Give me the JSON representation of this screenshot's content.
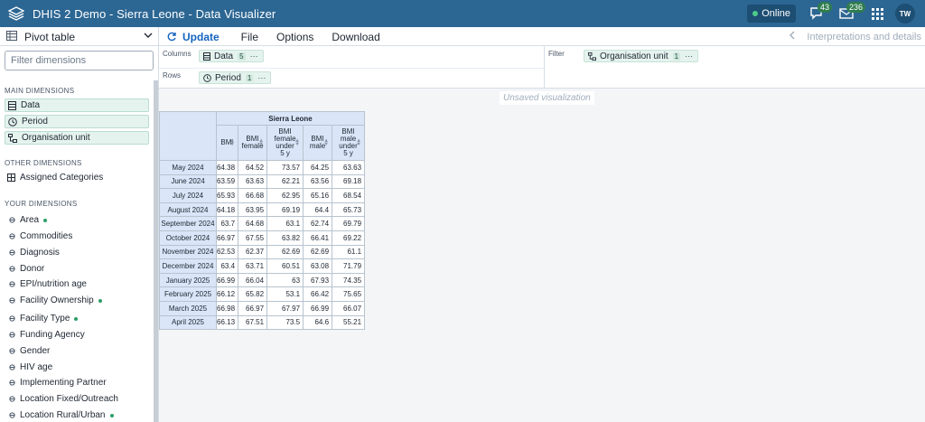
{
  "header": {
    "title": "DHIS 2 Demo - Sierra Leone - Data Visualizer",
    "status": "Online",
    "interpretations_badge": "43",
    "messages_badge": "236",
    "user_initials": "TW"
  },
  "toolbar": {
    "vis_type": "Pivot table",
    "update": "Update",
    "file": "File",
    "options": "Options",
    "download": "Download",
    "interpretations": "Interpretations and details"
  },
  "sidebar": {
    "filter_placeholder": "Filter dimensions",
    "main_title": "MAIN DIMENSIONS",
    "main": [
      "Data",
      "Period",
      "Organisation unit"
    ],
    "other_title": "OTHER DIMENSIONS",
    "other": [
      "Assigned Categories"
    ],
    "your_title": "YOUR DIMENSIONS",
    "your": [
      {
        "label": "Area",
        "active": true
      },
      {
        "label": "Commodities",
        "active": false
      },
      {
        "label": "Diagnosis",
        "active": false
      },
      {
        "label": "Donor",
        "active": false
      },
      {
        "label": "EPI/nutrition age",
        "active": false
      },
      {
        "label": "Facility Ownership",
        "active": true
      },
      {
        "label": "Facility Type",
        "active": true
      },
      {
        "label": "Funding Agency",
        "active": false
      },
      {
        "label": "Gender",
        "active": false
      },
      {
        "label": "HIV age",
        "active": false
      },
      {
        "label": "Implementing Partner",
        "active": false
      },
      {
        "label": "Location Fixed/Outreach",
        "active": false
      },
      {
        "label": "Location Rural/Urban",
        "active": true
      }
    ]
  },
  "layout": {
    "columns_label": "Columns",
    "rows_label": "Rows",
    "filter_label": "Filter",
    "columns_chip": {
      "label": "Data",
      "count": "5"
    },
    "rows_chip": {
      "label": "Period",
      "count": "1"
    },
    "filter_chip": {
      "label": "Organisation unit",
      "count": "1"
    }
  },
  "canvas": {
    "unsaved": "Unsaved visualization"
  },
  "table": {
    "org_unit": "Sierra Leone",
    "columns": [
      [
        "BMI"
      ],
      [
        "BMI",
        "female"
      ],
      [
        "BMI",
        "female",
        "under",
        "5 y"
      ],
      [
        "BMI",
        "male"
      ],
      [
        "BMI",
        "male",
        "under",
        "5 y"
      ]
    ],
    "rows": [
      {
        "period": "May 2024",
        "values": [
          "64.38",
          "64.52",
          "73.57",
          "64.25",
          "63.63"
        ]
      },
      {
        "period": "June 2024",
        "values": [
          "63.59",
          "63.63",
          "62.21",
          "63.56",
          "69.18"
        ]
      },
      {
        "period": "July 2024",
        "values": [
          "65.93",
          "66.68",
          "62.95",
          "65.16",
          "68.54"
        ]
      },
      {
        "period": "August 2024",
        "values": [
          "64.18",
          "63.95",
          "69.19",
          "64.4",
          "65.73"
        ]
      },
      {
        "period": "September 2024",
        "values": [
          "63.7",
          "64.68",
          "63.1",
          "62.74",
          "69.79"
        ]
      },
      {
        "period": "October 2024",
        "values": [
          "66.97",
          "67.55",
          "63.82",
          "66.41",
          "69.22"
        ]
      },
      {
        "period": "November 2024",
        "values": [
          "62.53",
          "62.37",
          "62.69",
          "62.69",
          "61.1"
        ]
      },
      {
        "period": "December 2024",
        "values": [
          "63.4",
          "63.71",
          "60.51",
          "63.08",
          "71.79"
        ]
      },
      {
        "period": "January 2025",
        "values": [
          "66.99",
          "66.04",
          "63",
          "67.93",
          "74.35"
        ]
      },
      {
        "period": "February 2025",
        "values": [
          "66.12",
          "65.82",
          "53.1",
          "66.42",
          "75.65"
        ]
      },
      {
        "period": "March 2025",
        "values": [
          "66.98",
          "66.97",
          "67.97",
          "66.99",
          "66.07"
        ]
      },
      {
        "period": "April 2025",
        "values": [
          "66.13",
          "67.51",
          "73.5",
          "64.6",
          "55.21"
        ]
      }
    ]
  }
}
